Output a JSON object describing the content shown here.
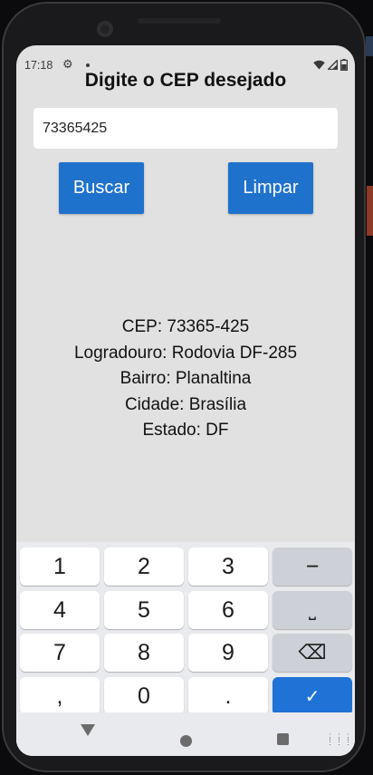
{
  "status_bar": {
    "time": "17:18",
    "icons": [
      "settings-icon",
      "notification-dot",
      "wifi-icon",
      "signal-icon",
      "battery-icon"
    ]
  },
  "form": {
    "title": "Digite o CEP desejado",
    "cep_value": "73365425",
    "search_label": "Buscar",
    "clear_label": "Limpar",
    "accent_color": "#1f72cc"
  },
  "result": {
    "cep": "CEP: 73365-425",
    "logradouro": "Logradouro: Rodovia DF-285",
    "bairro": "Bairro: Planaltina",
    "cidade": "Cidade: Brasília",
    "estado": "Estado: DF"
  },
  "keyboard": {
    "keys": {
      "k1": "1",
      "k2": "2",
      "k3": "3",
      "minus": "−",
      "k4": "4",
      "k5": "5",
      "k6": "6",
      "space": "⎵",
      "k7": "7",
      "k8": "8",
      "k9": "9",
      "backspace": "⌫",
      "comma": ",",
      "k0": "0",
      "period": ".",
      "enter": "✓"
    }
  },
  "nav_bar": {
    "icons": [
      "back-icon",
      "home-icon",
      "recents-icon",
      "keyboard-switch-icon"
    ]
  }
}
